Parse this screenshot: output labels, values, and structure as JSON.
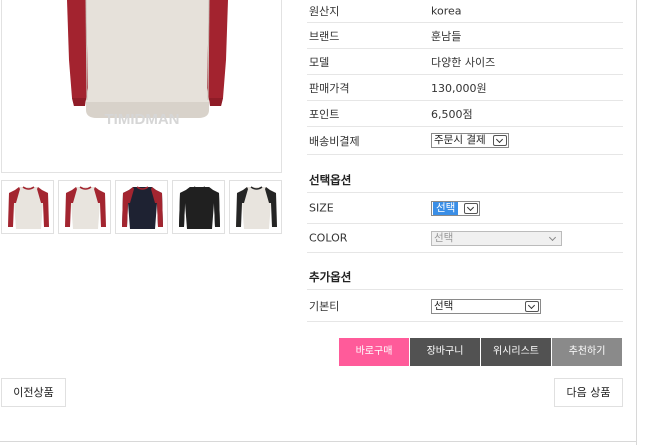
{
  "product_image": {
    "watermark": "TIMIDMAN",
    "colors": {
      "body": "#e6e1da",
      "sleeve": "#a3232f",
      "collar": "#a3232f"
    }
  },
  "thumbnails": [
    {
      "name": "red",
      "body": "#e8e4de",
      "sleeve": "#a32530"
    },
    {
      "name": "red-2",
      "body": "#e8e4de",
      "sleeve": "#a32530"
    },
    {
      "name": "navy",
      "body": "#1e2232",
      "sleeve": "#a32530"
    },
    {
      "name": "black",
      "body": "#202020",
      "sleeve": "#202020"
    },
    {
      "name": "black-sleeve",
      "body": "#e8e4de",
      "sleeve": "#252525"
    }
  ],
  "info": {
    "origin": {
      "label": "원산지",
      "value": "korea"
    },
    "brand": {
      "label": "브랜드",
      "value": "훈남들"
    },
    "model": {
      "label": "모델",
      "value": "다양한 사이즈"
    },
    "price": {
      "label": "판매가격",
      "value": "130,000원"
    },
    "point": {
      "label": "포인트",
      "value": "6,500점"
    },
    "shipping": {
      "label": "배송비결제",
      "value": "주문시 결제"
    }
  },
  "options": {
    "title": "선택옵션",
    "size": {
      "label": "SIZE",
      "value": "선택"
    },
    "color": {
      "label": "COLOR",
      "value": "선택"
    }
  },
  "extra": {
    "title": "추가옵션",
    "basic": {
      "label": "기본티",
      "value": "선택"
    }
  },
  "actions": {
    "buy": "바로구매",
    "cart": "장바구니",
    "wish": "위시리스트",
    "recommend": "추천하기"
  },
  "nav": {
    "prev": "이전상품",
    "next": "다음 상품"
  },
  "colors": {
    "buy_button": "#ff5b9a",
    "dark_button": "#525252",
    "gray_button": "#8a8a8a"
  }
}
